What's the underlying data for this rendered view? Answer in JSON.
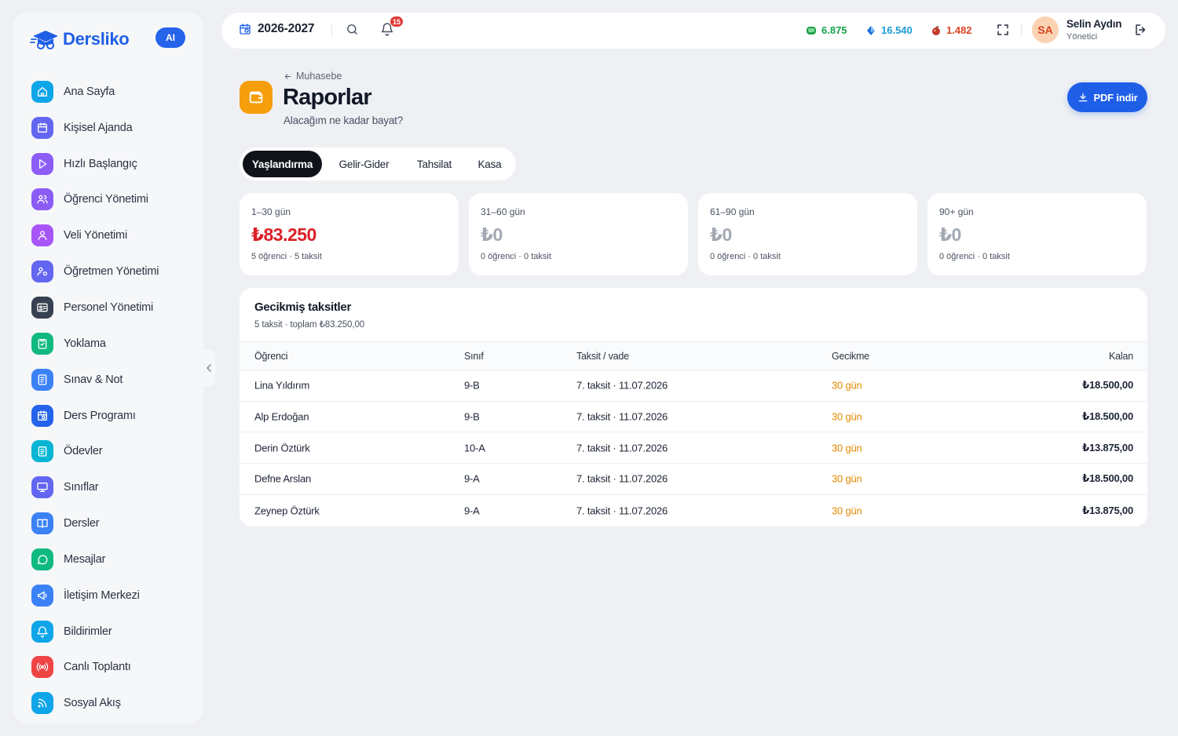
{
  "brand": {
    "name": "Dersliko",
    "ai_label": "AI"
  },
  "sidebar": {
    "items": [
      {
        "label": "Ana Sayfa",
        "icon": "home-icon",
        "color": "#0ea5e9"
      },
      {
        "label": "Kişisel Ajanda",
        "icon": "calendar-icon",
        "color": "#6366f1"
      },
      {
        "label": "Hızlı Başlangıç",
        "icon": "play-icon",
        "color": "#8b5cf6"
      },
      {
        "label": "Öğrenci Yönetimi",
        "icon": "users-icon",
        "color": "#8b5cf6"
      },
      {
        "label": "Veli Yönetimi",
        "icon": "parent-icon",
        "color": "#a855f7"
      },
      {
        "label": "Öğretmen Yönetimi",
        "icon": "teacher-icon",
        "color": "#6366f1"
      },
      {
        "label": "Personel Yönetimi",
        "icon": "id-card-icon",
        "color": "#374151"
      },
      {
        "label": "Yoklama",
        "icon": "clipboard-check-icon",
        "color": "#10b981"
      },
      {
        "label": "Sınav & Not",
        "icon": "exam-icon",
        "color": "#3b82f6"
      },
      {
        "label": "Ders Programı",
        "icon": "schedule-icon",
        "color": "#2563eb"
      },
      {
        "label": "Ödevler",
        "icon": "homework-icon",
        "color": "#06b6d4"
      },
      {
        "label": "Sınıflar",
        "icon": "classroom-icon",
        "color": "#6366f1"
      },
      {
        "label": "Dersler",
        "icon": "book-icon",
        "color": "#3b82f6"
      },
      {
        "label": "Mesajlar",
        "icon": "message-icon",
        "color": "#10b981"
      },
      {
        "label": "İletişim Merkezi",
        "icon": "megaphone-icon",
        "color": "#3b82f6"
      },
      {
        "label": "Bildirimler",
        "icon": "bell-icon",
        "color": "#0ea5e9"
      },
      {
        "label": "Canlı Toplantı",
        "icon": "broadcast-icon",
        "color": "#ef4444"
      },
      {
        "label": "Sosyal Akış",
        "icon": "rss-icon",
        "color": "#0ea5e9"
      }
    ]
  },
  "topbar": {
    "year": "2026-2027",
    "notifications": "15",
    "stats": [
      {
        "value": "6.875",
        "color": "#16a34a",
        "icon": "green-gem-icon"
      },
      {
        "value": "16.540",
        "color": "#1e9bd7",
        "icon": "blue-gem-icon"
      },
      {
        "value": "1.482",
        "color": "#d9431f",
        "icon": "ruby-icon"
      }
    ],
    "user": {
      "initials": "SA",
      "name": "Selin Aydın",
      "role": "Yönetici"
    }
  },
  "header": {
    "breadcrumb": "Muhasebe",
    "title": "Raporlar",
    "subtitle": "Alacağım ne kadar bayat?",
    "pdf_button": "PDF indir"
  },
  "tabs": [
    {
      "label": "Yaşlandırma",
      "active": true
    },
    {
      "label": "Gelir-Gider",
      "active": false
    },
    {
      "label": "Tahsilat",
      "active": false
    },
    {
      "label": "Kasa",
      "active": false
    }
  ],
  "cards": [
    {
      "label": "1–30 gün",
      "amount": "₺83.250",
      "meta": "5 öğrenci · 5 taksit",
      "color": "#dc1f26"
    },
    {
      "label": "31–60 gün",
      "amount": "₺0",
      "meta": "0 öğrenci · 0 taksit",
      "color": "#a3a9b3"
    },
    {
      "label": "61–90 gün",
      "amount": "₺0",
      "meta": "0 öğrenci · 0 taksit",
      "color": "#a3a9b3"
    },
    {
      "label": "90+ gün",
      "amount": "₺0",
      "meta": "0 öğrenci · 0 taksit",
      "color": "#a3a9b3"
    }
  ],
  "overdue": {
    "title": "Gecikmiş taksitler",
    "subtitle": "5 taksit · toplam ₺83.250,00",
    "columns": [
      "Öğrenci",
      "Sınıf",
      "Taksit / vade",
      "Gecikme",
      "Kalan"
    ],
    "rows": [
      {
        "student": "Lina Yıldırım",
        "class": "9-B",
        "installment": "7. taksit · 11.07.2026",
        "delay": "30 gün",
        "remaining": "₺18.500,00"
      },
      {
        "student": "Alp Erdoğan",
        "class": "9-B",
        "installment": "7. taksit · 11.07.2026",
        "delay": "30 gün",
        "remaining": "₺18.500,00"
      },
      {
        "student": "Derin Öztürk",
        "class": "10-A",
        "installment": "7. taksit · 11.07.2026",
        "delay": "30 gün",
        "remaining": "₺13.875,00"
      },
      {
        "student": "Defne Arslan",
        "class": "9-A",
        "installment": "7. taksit · 11.07.2026",
        "delay": "30 gün",
        "remaining": "₺18.500,00"
      },
      {
        "student": "Zeynep Öztürk",
        "class": "9-A",
        "installment": "7. taksit · 11.07.2026",
        "delay": "30 gün",
        "remaining": "₺13.875,00"
      }
    ]
  }
}
